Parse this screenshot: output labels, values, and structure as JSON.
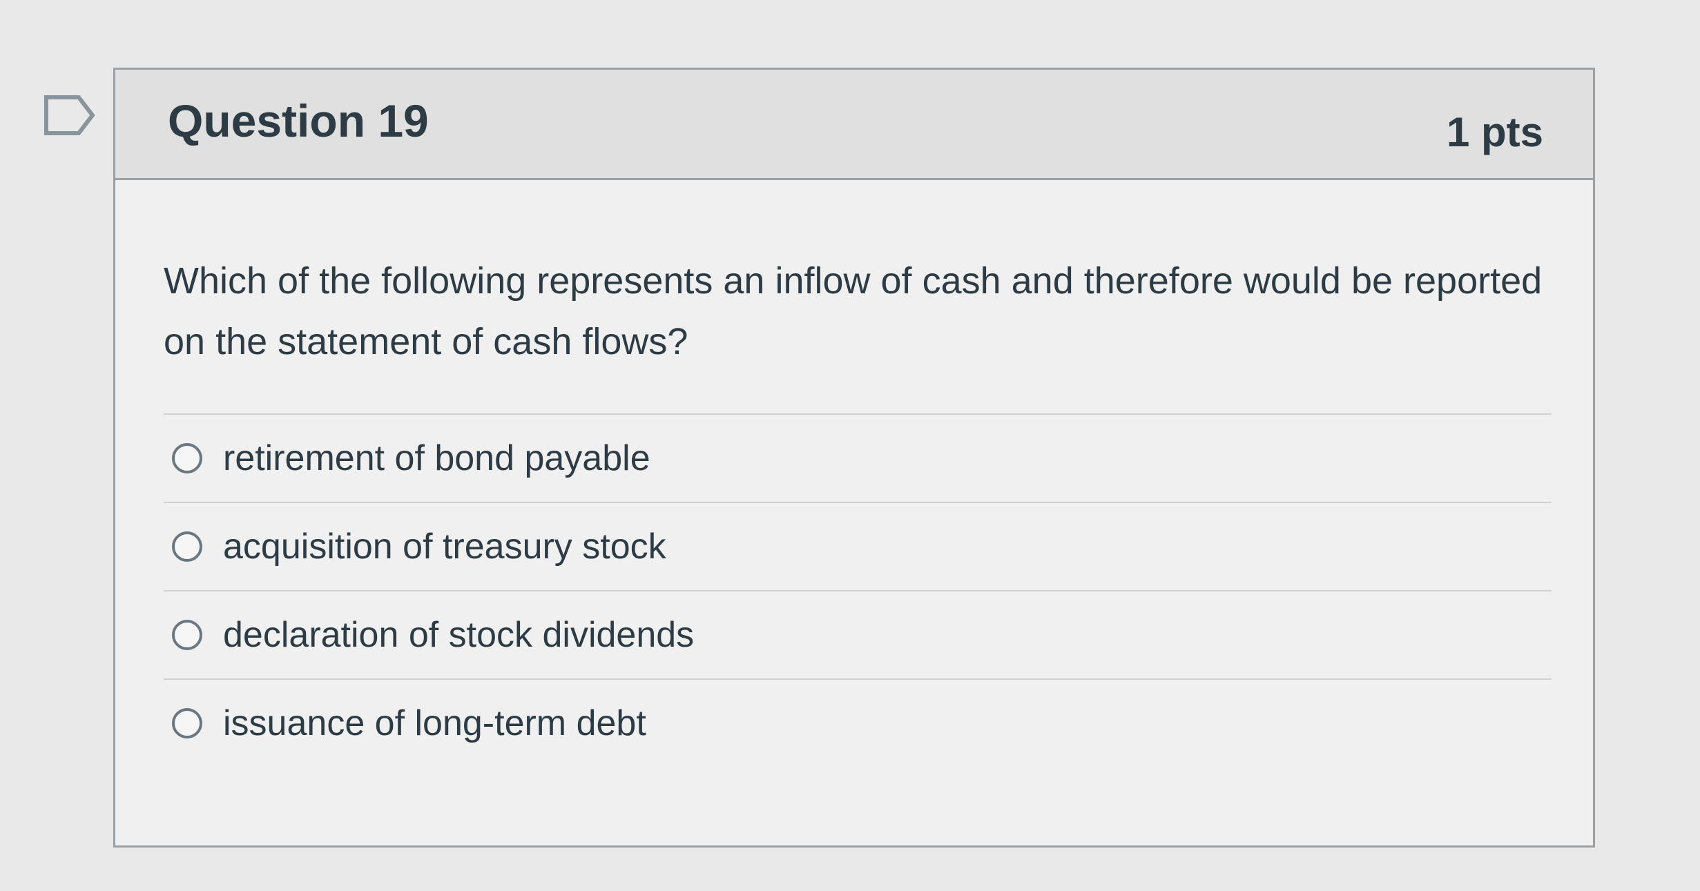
{
  "question": {
    "title": "Question 19",
    "points": "1 pts",
    "text": "Which of the following represents an inflow of cash and therefore would be reported on the statement of cash flows?",
    "answers": [
      {
        "label": "retirement of bond payable",
        "selected": false
      },
      {
        "label": "acquisition of treasury stock",
        "selected": false
      },
      {
        "label": "declaration of stock dividends",
        "selected": false
      },
      {
        "label": "issuance of long-term debt",
        "selected": false
      }
    ]
  },
  "icons": {
    "flag": "flag-question-icon"
  },
  "colors": {
    "header_bg": "#e0e0e0",
    "text": "#2d3b45",
    "border": "#9aa0a4"
  }
}
